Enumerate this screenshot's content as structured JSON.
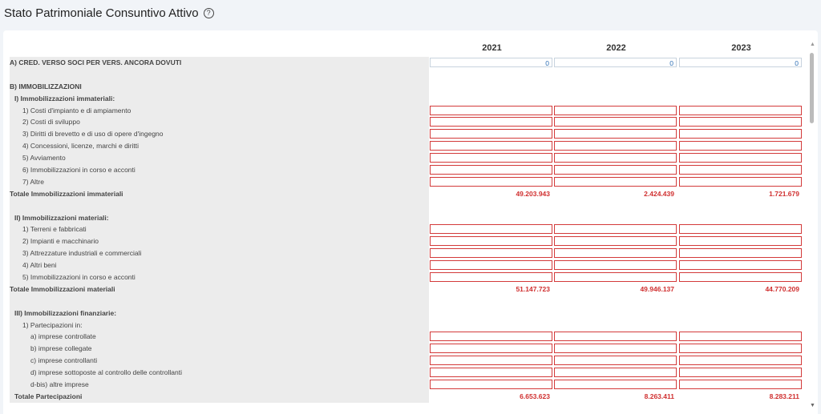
{
  "page": {
    "title": "Stato Patrimoniale Consuntivo Attivo",
    "help_icon": "?"
  },
  "years": [
    "2021",
    "2022",
    "2023"
  ],
  "rows": [
    {
      "label": "A) CRED. VERSO SOCI PER VERS. ANCORA DOVUTI",
      "indent": 0,
      "bold": true,
      "kind": "blue",
      "values": [
        "0",
        "0",
        "0"
      ]
    },
    {
      "label": "",
      "indent": 0,
      "bold": false,
      "kind": "blank"
    },
    {
      "label": "B) IMMOBILIZZAZIONI",
      "indent": 0,
      "bold": true,
      "kind": "header"
    },
    {
      "label": "I) Immobilizzazioni immateriali:",
      "indent": 1,
      "bold": true,
      "kind": "header"
    },
    {
      "label": "1) Costi d'impianto e di ampiamento",
      "indent": 2,
      "bold": false,
      "kind": "red"
    },
    {
      "label": "2) Costi di sviluppo",
      "indent": 2,
      "bold": false,
      "kind": "red"
    },
    {
      "label": "3) Diritti di brevetto e di uso di opere d'ingegno",
      "indent": 2,
      "bold": false,
      "kind": "red"
    },
    {
      "label": "4) Concessioni, licenze, marchi e diritti",
      "indent": 2,
      "bold": false,
      "kind": "red"
    },
    {
      "label": "5) Avviamento",
      "indent": 2,
      "bold": false,
      "kind": "red"
    },
    {
      "label": "6) Immobilizzazioni in corso e acconti",
      "indent": 2,
      "bold": false,
      "kind": "red"
    },
    {
      "label": "7) Altre",
      "indent": 2,
      "bold": false,
      "kind": "red"
    },
    {
      "label": "Totale Immobilizzazioni immateriali",
      "indent": 0,
      "bold": true,
      "kind": "total",
      "values": [
        "49.203.943",
        "2.424.439",
        "1.721.679"
      ]
    },
    {
      "label": "",
      "indent": 0,
      "bold": false,
      "kind": "blank"
    },
    {
      "label": "II) Immobilizzazioni materiali:",
      "indent": 1,
      "bold": true,
      "kind": "header"
    },
    {
      "label": "1) Terreni e fabbricati",
      "indent": 2,
      "bold": false,
      "kind": "red"
    },
    {
      "label": "2) Impianti e macchinario",
      "indent": 2,
      "bold": false,
      "kind": "red"
    },
    {
      "label": "3) Attrezzature industriali e commerciali",
      "indent": 2,
      "bold": false,
      "kind": "red"
    },
    {
      "label": "4) Altri beni",
      "indent": 2,
      "bold": false,
      "kind": "red"
    },
    {
      "label": "5) Immobilizzazioni in corso e acconti",
      "indent": 2,
      "bold": false,
      "kind": "red"
    },
    {
      "label": "Totale Immobilizzazioni materiali",
      "indent": 0,
      "bold": true,
      "kind": "total",
      "values": [
        "51.147.723",
        "49.946.137",
        "44.770.209"
      ]
    },
    {
      "label": "",
      "indent": 0,
      "bold": false,
      "kind": "blank"
    },
    {
      "label": "III) Immobilizzazioni finanziarie:",
      "indent": 1,
      "bold": true,
      "kind": "header"
    },
    {
      "label": "1) Partecipazioni in:",
      "indent": 2,
      "bold": false,
      "kind": "header"
    },
    {
      "label": "a) imprese controllate",
      "indent": 3,
      "bold": false,
      "kind": "red"
    },
    {
      "label": "b) imprese collegate",
      "indent": 3,
      "bold": false,
      "kind": "red"
    },
    {
      "label": "c) imprese controllanti",
      "indent": 3,
      "bold": false,
      "kind": "red"
    },
    {
      "label": "d) imprese sottoposte al controllo delle controllanti",
      "indent": 3,
      "bold": false,
      "kind": "red"
    },
    {
      "label": "d-bis) altre imprese",
      "indent": 3,
      "bold": false,
      "kind": "red"
    },
    {
      "label": "Totale Partecipazioni",
      "indent": 1,
      "bold": true,
      "kind": "total",
      "values": [
        "6.653.623",
        "8.263.411",
        "8.283.211"
      ]
    }
  ]
}
